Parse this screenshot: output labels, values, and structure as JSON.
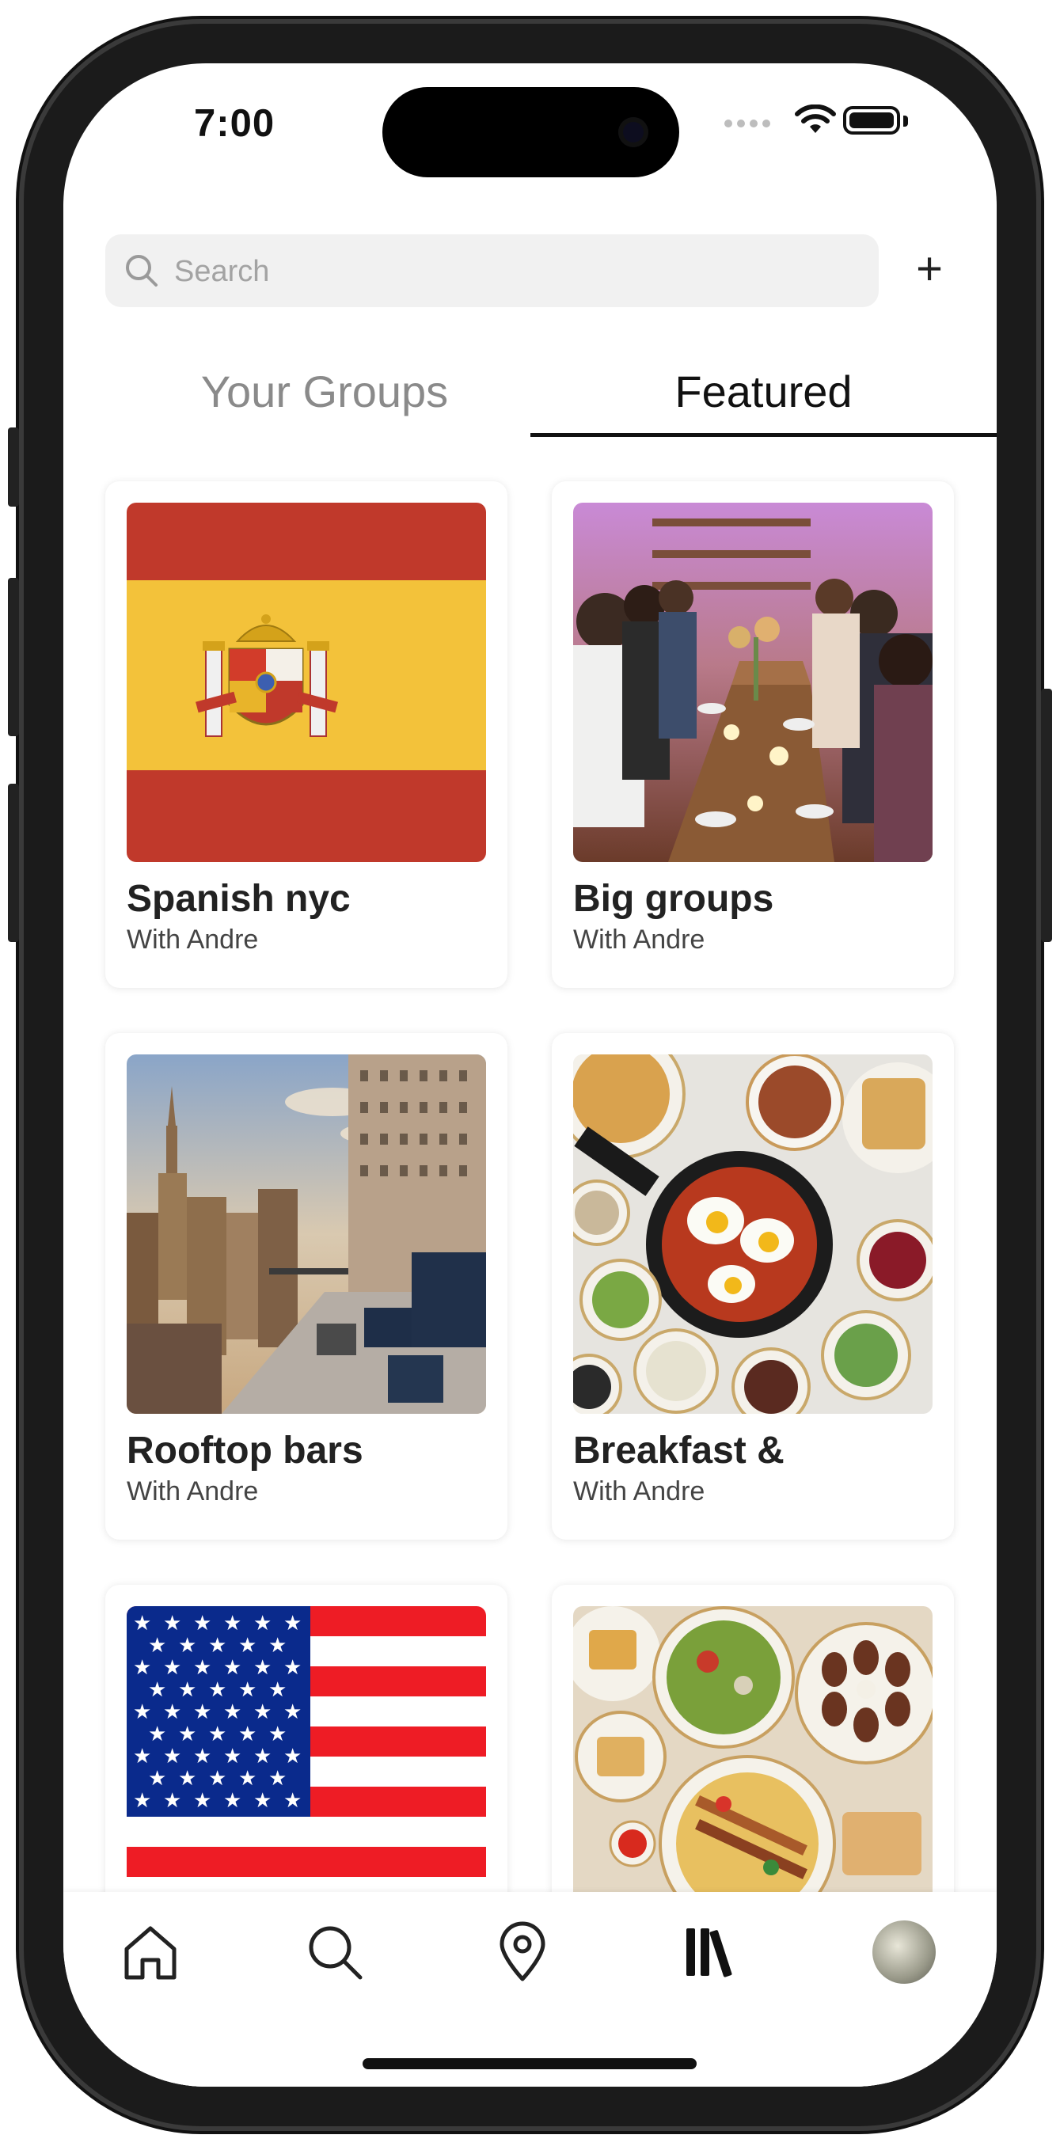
{
  "status_bar": {
    "time": "7:00"
  },
  "search": {
    "placeholder": "Search",
    "icon": "search-icon"
  },
  "header": {
    "add_label": "+"
  },
  "tabs": [
    {
      "label": "Your Groups",
      "active": false
    },
    {
      "label": "Featured",
      "active": true
    }
  ],
  "groups": [
    {
      "title": "Spanish nyc",
      "subtitle": "With Andre",
      "image": "spain-flag"
    },
    {
      "title": "Big groups",
      "subtitle": "With Andre",
      "image": "group-dinner-photo"
    },
    {
      "title": "Rooftop bars",
      "subtitle": "With Andre",
      "image": "nyc-rooftop-photo"
    },
    {
      "title": "Breakfast &",
      "subtitle": "With Andre",
      "image": "breakfast-spread-photo"
    },
    {
      "title": "",
      "subtitle": "",
      "image": "usa-flag"
    },
    {
      "title": "",
      "subtitle": "",
      "image": "middle-eastern-food-photo"
    }
  ],
  "nav": [
    {
      "icon": "home-icon",
      "active": false
    },
    {
      "icon": "search-icon",
      "active": false
    },
    {
      "icon": "map-pin-icon",
      "active": false
    },
    {
      "icon": "library-icon",
      "active": true
    },
    {
      "icon": "profile-avatar",
      "active": false
    }
  ],
  "colors": {
    "accent": "#111111",
    "muted_tab": "#8a8a8a",
    "spain_red": "#c0392b",
    "spain_yellow": "#f3c23a",
    "usa_blue": "#0a2a8c",
    "usa_red": "#ee1c25"
  }
}
